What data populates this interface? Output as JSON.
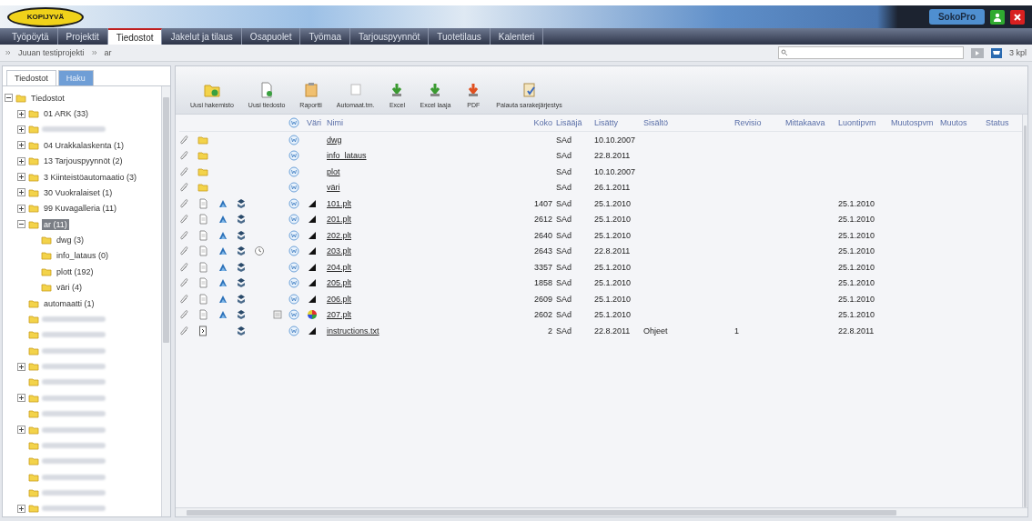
{
  "logo": {
    "text": "KOPIJYVÄ"
  },
  "product_badge": {
    "text": "SokoPro"
  },
  "tabs": [
    {
      "label": "Työpöytä",
      "selected": false
    },
    {
      "label": "Projektit",
      "selected": false
    },
    {
      "label": "Tiedostot",
      "selected": true
    },
    {
      "label": "Jakelut ja tilaus",
      "selected": false
    },
    {
      "label": "Osapuolet",
      "selected": false
    },
    {
      "label": "Työmaa",
      "selected": false
    },
    {
      "label": "Tarjouspyynnöt",
      "selected": false
    },
    {
      "label": "Tuotetilaus",
      "selected": false
    },
    {
      "label": "Kalenteri",
      "selected": false
    }
  ],
  "breadcrumb": [
    "Juuan testiprojekti",
    "ar"
  ],
  "count": "3 kpl",
  "side_tabs": [
    {
      "label": "Tiedostot",
      "selected": true
    },
    {
      "label": "Haku",
      "selected": false
    }
  ],
  "tree": [
    {
      "label": "Tiedostot",
      "expanded": true,
      "selected": false,
      "children": [
        {
          "label": "01 ARK (33)",
          "expanded": false,
          "selected": false
        },
        {
          "kind": "blurred",
          "expanded": false
        },
        {
          "label": "04 Urakkalaskenta (1)",
          "expanded": false,
          "selected": false
        },
        {
          "label": "13 Tarjouspyynnöt (2)",
          "expanded": false,
          "selected": false
        },
        {
          "label": "3 Kiinteistöautomaatio (3)",
          "expanded": false,
          "selected": false
        },
        {
          "label": "30 Vuokralaiset (1)",
          "expanded": false,
          "selected": false
        },
        {
          "label": "99 Kuvagalleria (11)",
          "expanded": false,
          "selected": false
        },
        {
          "label": "ar (11)",
          "expanded": true,
          "selected": true,
          "children": [
            {
              "label": "dwg (3)",
              "selected": false
            },
            {
              "label": "info_lataus (0)",
              "selected": false
            },
            {
              "label": "plott (192)",
              "selected": false
            },
            {
              "label": "väri (4)",
              "selected": false
            }
          ]
        },
        {
          "label": "automaatti (1)",
          "selected": false
        },
        {
          "kind": "blurred"
        },
        {
          "kind": "blurred"
        },
        {
          "kind": "blurred"
        },
        {
          "kind": "blurred",
          "expanded": false
        },
        {
          "kind": "blurred"
        },
        {
          "kind": "blurred",
          "expanded": false
        },
        {
          "kind": "blurred"
        },
        {
          "kind": "blurred",
          "expanded": false
        },
        {
          "kind": "blurred"
        },
        {
          "kind": "blurred"
        },
        {
          "kind": "blurred"
        },
        {
          "kind": "blurred"
        },
        {
          "kind": "blurred",
          "expanded": false
        }
      ]
    }
  ],
  "toolbar": [
    {
      "label": "Uusi hakemisto",
      "kind": "folder"
    },
    {
      "label": "Uusi tiedosto",
      "kind": "file"
    },
    {
      "label": "Raportti",
      "kind": "report"
    },
    {
      "label": "Automaat.tm.",
      "kind": "blank"
    },
    {
      "label": "Excel",
      "kind": "excel"
    },
    {
      "label": "Excel laaja",
      "kind": "excel"
    },
    {
      "label": "PDF",
      "kind": "pdf"
    },
    {
      "label": "Palauta sarakejärjestys",
      "kind": "columns"
    }
  ],
  "columns": [
    "Väri",
    "Nimi",
    "Koko",
    "Lisääjä",
    "Lisätty",
    "Sisältö",
    "Revisio",
    "Mittakaava",
    "Luontipvm",
    "Muutospvm",
    "Muutos",
    "Status"
  ],
  "rows": [
    {
      "kind": "folder",
      "name": "dwg",
      "adder": "SAd",
      "added": "10.10.2007"
    },
    {
      "kind": "folder",
      "name": "info_lataus",
      "adder": "SAd",
      "added": "22.8.2011"
    },
    {
      "kind": "folder",
      "name": "plot",
      "adder": "SAd",
      "added": "10.10.2007"
    },
    {
      "kind": "folder",
      "name": "väri",
      "adder": "SAd",
      "added": "26.1.2011"
    },
    {
      "kind": "file",
      "layers": true,
      "multicolor": false,
      "name": "101.plt",
      "size": "1407",
      "adder": "SAd",
      "added": "25.1.2010",
      "created": "25.1.2010"
    },
    {
      "kind": "file",
      "layers": true,
      "multicolor": false,
      "name": "201.plt",
      "size": "2612",
      "adder": "SAd",
      "added": "25.1.2010",
      "created": "25.1.2010"
    },
    {
      "kind": "file",
      "layers": true,
      "multicolor": false,
      "name": "202.plt",
      "size": "2640",
      "adder": "SAd",
      "added": "25.1.2010",
      "created": "25.1.2010"
    },
    {
      "kind": "file",
      "layers": true,
      "clock": true,
      "multicolor": false,
      "name": "203.plt",
      "size": "2643",
      "adder": "SAd",
      "added": "22.8.2011",
      "created": "25.1.2010"
    },
    {
      "kind": "file",
      "layers": true,
      "multicolor": false,
      "name": "204.plt",
      "size": "3357",
      "adder": "SAd",
      "added": "25.1.2010",
      "created": "25.1.2010"
    },
    {
      "kind": "file",
      "layers": true,
      "multicolor": false,
      "name": "205.plt",
      "size": "1858",
      "adder": "SAd",
      "added": "25.1.2010",
      "created": "25.1.2010"
    },
    {
      "kind": "file",
      "layers": true,
      "multicolor": false,
      "name": "206.plt",
      "size": "2609",
      "adder": "SAd",
      "added": "25.1.2010",
      "created": "25.1.2010"
    },
    {
      "kind": "file",
      "layers": true,
      "note": true,
      "multicolor": true,
      "name": "207.plt",
      "size": "2602",
      "adder": "SAd",
      "added": "25.1.2010",
      "created": "25.1.2010"
    },
    {
      "kind": "text",
      "stack_only": true,
      "multicolor": false,
      "name": "instructions.txt",
      "size": "2",
      "adder": "SAd",
      "added": "22.8.2011",
      "content": "Ohjeet",
      "revision": "1",
      "created": "22.8.2011"
    }
  ]
}
